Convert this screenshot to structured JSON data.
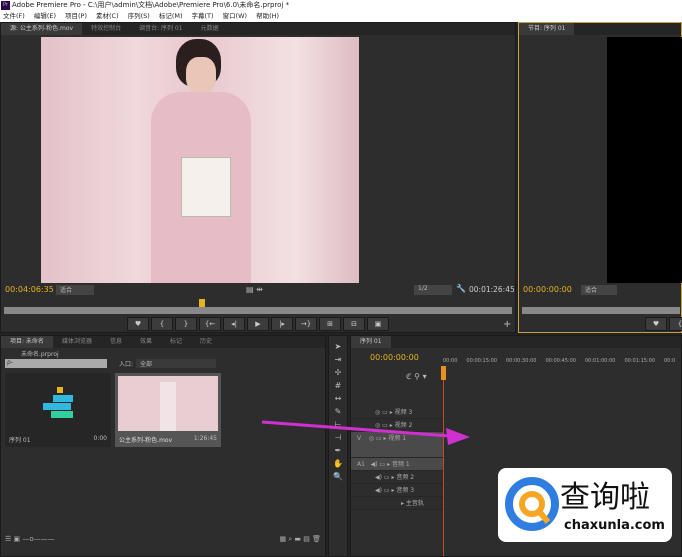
{
  "title": "Adobe Premiere Pro - C:\\用户\\admin\\文档\\Adobe\\Premiere Pro\\6.0\\未命名.prproj *",
  "app_icon": "Pr",
  "menu": [
    "文件(F)",
    "编辑(E)",
    "项目(P)",
    "素材(C)",
    "序列(S)",
    "标记(M)",
    "字幕(T)",
    "窗口(W)",
    "帮助(H)"
  ],
  "source": {
    "tabs": [
      "源: 公主系列-粉色.mov",
      "特效控制台",
      "调音台: 序列 01",
      "元数据"
    ],
    "timecode": "00:04:06:35",
    "fit": "适合",
    "resolution": "1/2",
    "duration": "00:01:26:45",
    "buttons": [
      "♥",
      "{",
      "}",
      "{←",
      "◂|",
      "▶",
      "|▸",
      "→}",
      "⊞",
      "⊟",
      "▣"
    ]
  },
  "program": {
    "tab": "节目: 序列 01",
    "timecode": "00:00:00:00",
    "fit": "适合",
    "buttons": [
      "♥",
      "{"
    ]
  },
  "project": {
    "tabs": [
      "项目: 未命名",
      "媒体浏览器",
      "信息",
      "效果",
      "标记",
      "历史"
    ],
    "file": "未命名.prproj",
    "search_placeholder": "ρ-",
    "in_label": "入口:",
    "in_value": "全部",
    "items": [
      {
        "name": "序列 01",
        "dur": "0:00"
      },
      {
        "name": "公主系列-粉色.mov",
        "dur": "1:26:45"
      }
    ]
  },
  "timeline": {
    "tab": "序列 01",
    "timecode": "00:00:00:00",
    "ruler": [
      "00:00",
      "00:00:15:00",
      "00:00:30:00",
      "00:00:45:00",
      "00:01:00:00",
      "00:01:15:00",
      "00:0"
    ],
    "tracks": [
      "视频 3",
      "视频 2",
      "视频 1",
      "音频 1",
      "音频 2",
      "音频 3",
      "主音轨"
    ],
    "v_label": "V",
    "a_label": "A1"
  },
  "watermark": {
    "text": "查询啦",
    "url": "chaxunla.com"
  }
}
